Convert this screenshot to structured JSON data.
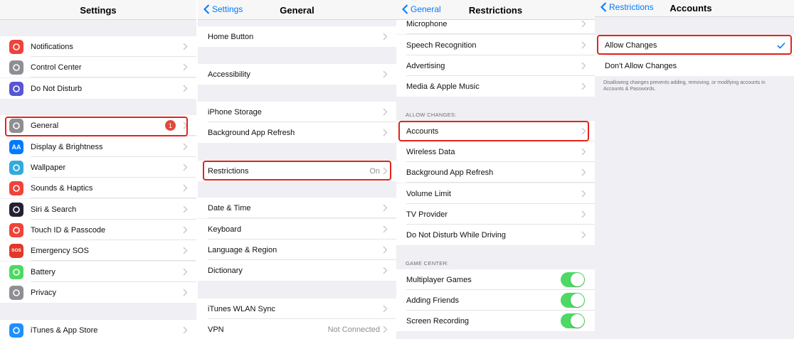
{
  "colors": {
    "accent": "#007aff",
    "highlight": "#e1251b",
    "toggle_on": "#4cd964",
    "badge": "#e14a3b"
  },
  "panel1": {
    "title": "Settings",
    "items": [
      {
        "label": "Notifications",
        "icon": "notifications-icon",
        "color": "#f0433a"
      },
      {
        "label": "Control Center",
        "icon": "control-center-icon",
        "color": "#8e8e93"
      },
      {
        "label": "Do Not Disturb",
        "icon": "moon-icon",
        "color": "#5856d6"
      },
      {
        "label": "General",
        "icon": "gear-icon",
        "color": "#8e8e93",
        "badge": "1"
      },
      {
        "label": "Display & Brightness",
        "icon": "display-icon",
        "color": "#007aff",
        "glyph": "AA"
      },
      {
        "label": "Wallpaper",
        "icon": "wallpaper-icon",
        "color": "#34aadc"
      },
      {
        "label": "Sounds & Haptics",
        "icon": "speaker-icon",
        "color": "#f0433a"
      },
      {
        "label": "Siri & Search",
        "icon": "siri-icon",
        "color": "#222233"
      },
      {
        "label": "Touch ID & Passcode",
        "icon": "fingerprint-icon",
        "color": "#f0433a"
      },
      {
        "label": "Emergency SOS",
        "icon": "sos-icon",
        "color": "#e0392b",
        "glyph": "SOS"
      },
      {
        "label": "Battery",
        "icon": "battery-icon",
        "color": "#4cd964"
      },
      {
        "label": "Privacy",
        "icon": "hand-icon",
        "color": "#8e8e93"
      },
      {
        "label": "iTunes & App Store",
        "icon": "app-store-icon",
        "color": "#1e90ff"
      }
    ]
  },
  "panel2": {
    "back": "Settings",
    "title": "General",
    "items": [
      {
        "label": "Home Button"
      },
      {
        "label": "Accessibility"
      },
      {
        "label": "iPhone Storage"
      },
      {
        "label": "Background App Refresh"
      },
      {
        "label": "Restrictions",
        "value": "On"
      },
      {
        "label": "Date & Time"
      },
      {
        "label": "Keyboard"
      },
      {
        "label": "Language & Region"
      },
      {
        "label": "Dictionary"
      },
      {
        "label": "iTunes WLAN Sync"
      },
      {
        "label": "VPN",
        "value": "Not Connected"
      }
    ]
  },
  "panel3": {
    "back": "General",
    "title": "Restrictions",
    "items": [
      {
        "label": "Microphone"
      },
      {
        "label": "Speech Recognition"
      },
      {
        "label": "Advertising"
      },
      {
        "label": "Media & Apple Music"
      },
      {
        "label": "Accounts"
      },
      {
        "label": "Wireless Data"
      },
      {
        "label": "Background App Refresh"
      },
      {
        "label": "Volume Limit"
      },
      {
        "label": "TV Provider"
      },
      {
        "label": "Do Not Disturb While Driving"
      },
      {
        "label": "Multiplayer Games",
        "toggle": true
      },
      {
        "label": "Adding Friends",
        "toggle": true
      },
      {
        "label": "Screen Recording",
        "toggle": true
      }
    ],
    "section_allow": "ALLOW CHANGES:",
    "section_game": "GAME CENTER:"
  },
  "panel4": {
    "back": "Restrictions",
    "title": "Accounts",
    "options": [
      {
        "label": "Allow Changes",
        "checked": true
      },
      {
        "label": "Don't Allow Changes",
        "checked": false
      }
    ],
    "footnote": "Disallowing changes prevents adding, removing, or modifying accounts in Accounts & Passwords."
  }
}
